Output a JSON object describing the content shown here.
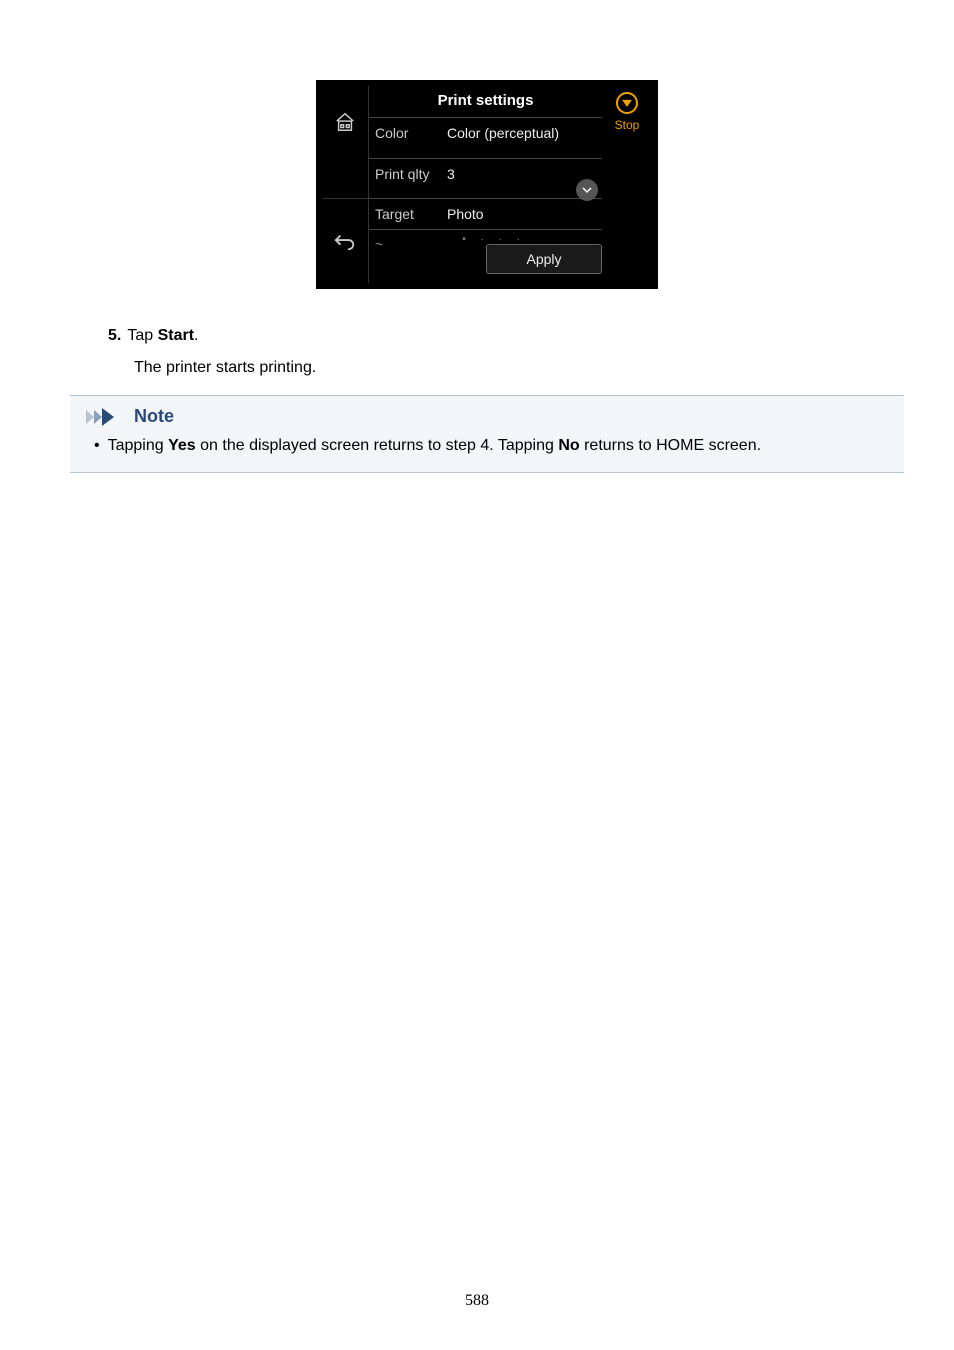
{
  "screen": {
    "title": "Print settings",
    "stop_label": "Stop",
    "settings": [
      {
        "label": "Color",
        "value": "Color (perceptual)"
      },
      {
        "label": "Print qlty",
        "value": "3"
      },
      {
        "label": "Target",
        "value": "Photo"
      }
    ],
    "apply_label": "Apply"
  },
  "step": {
    "number": "5.",
    "text_before": "Tap ",
    "bold": "Start",
    "text_after": "."
  },
  "subtext": "The printer starts printing.",
  "note": {
    "heading": "Note",
    "item_before": "Tapping ",
    "item_bold1": "Yes",
    "item_mid": " on the displayed screen returns to step 4. Tapping ",
    "item_bold2": "No",
    "item_after": " returns to HOME screen."
  },
  "page_number": "588"
}
